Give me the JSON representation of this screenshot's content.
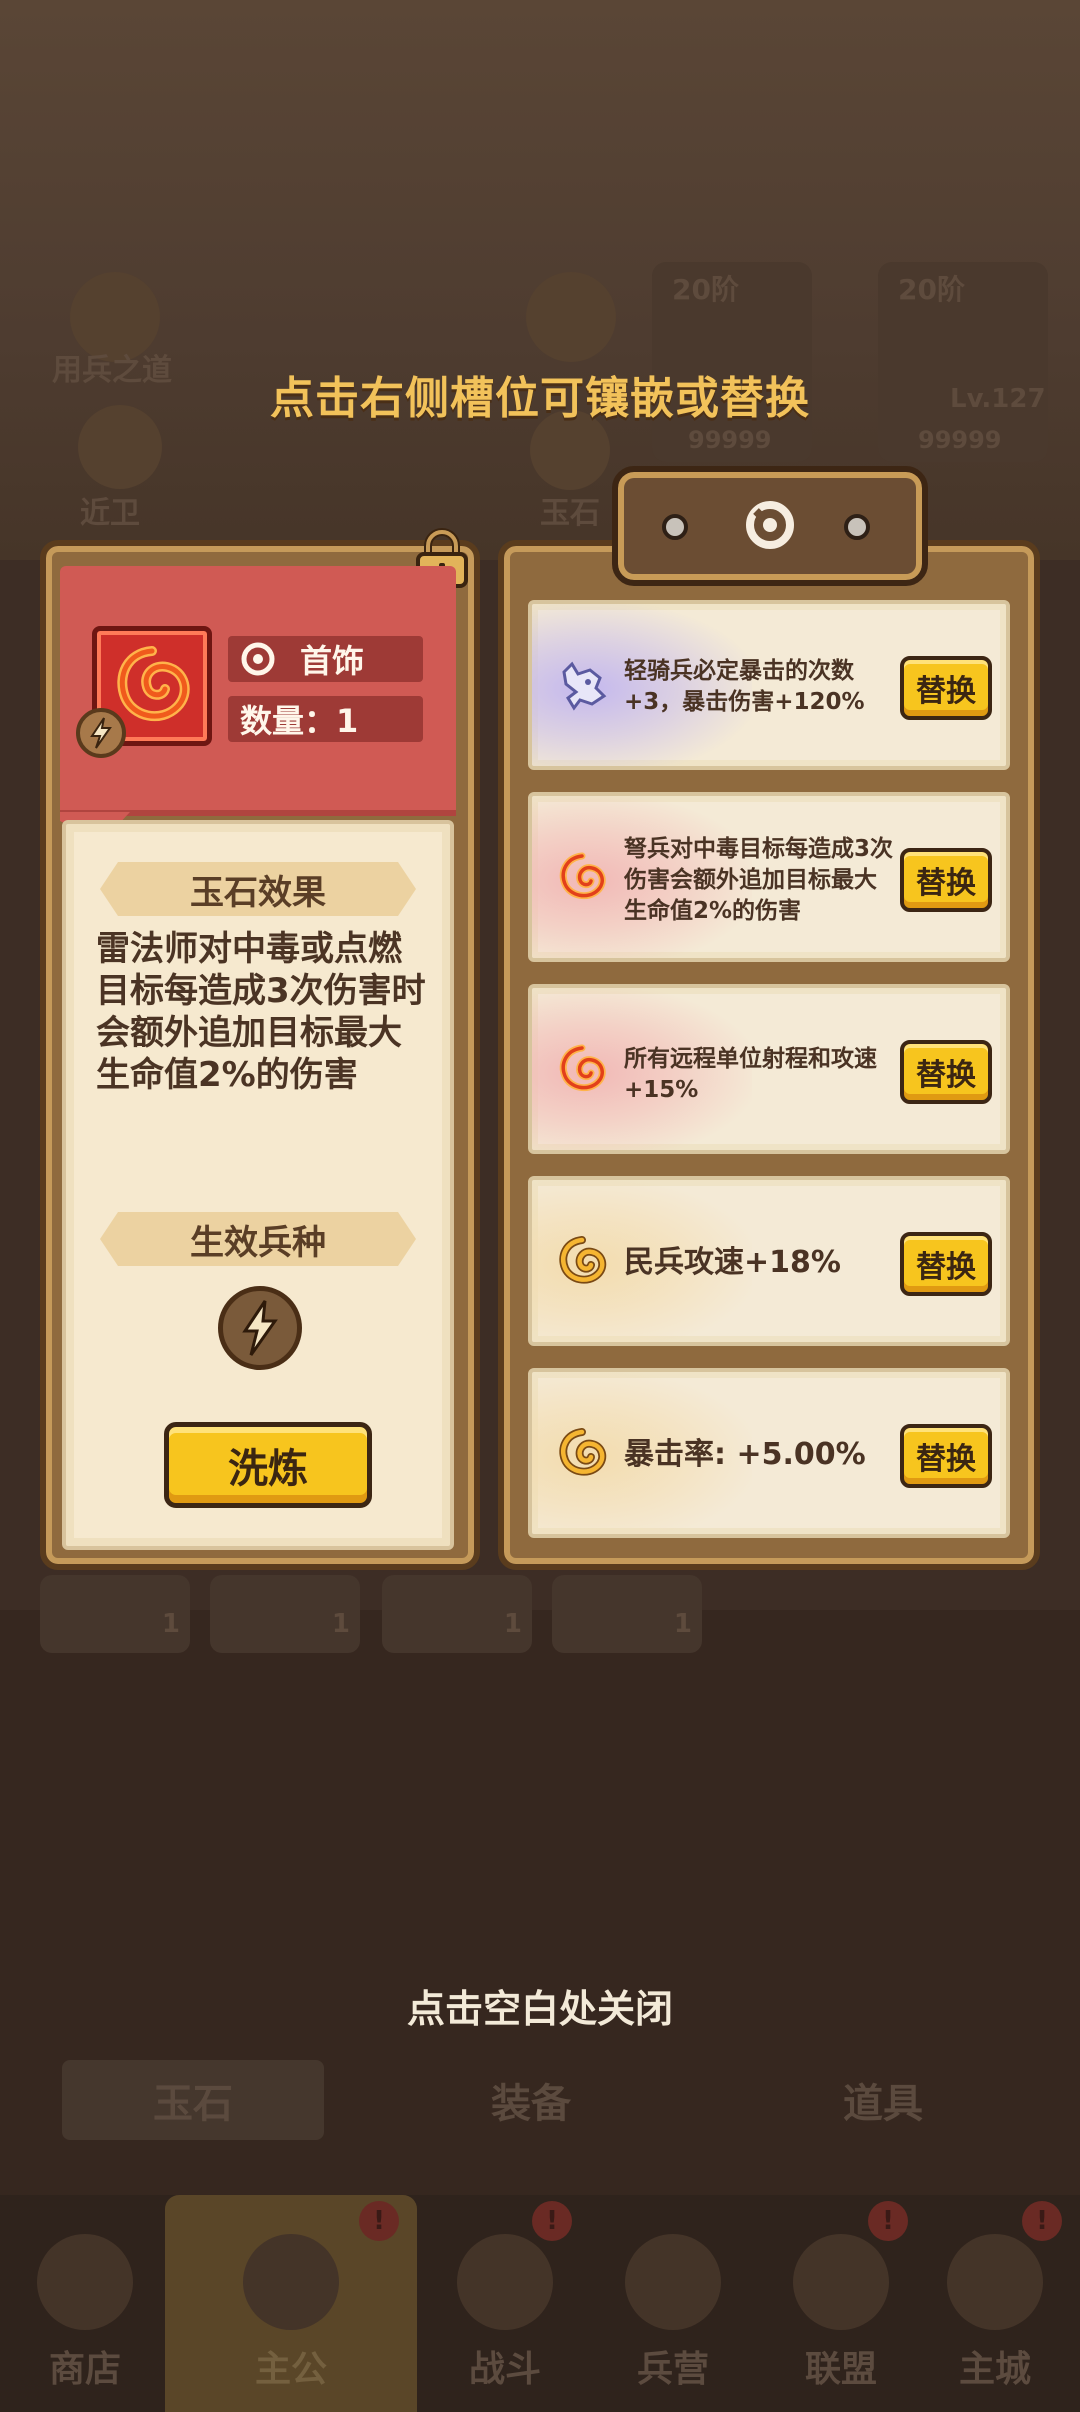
{
  "background": {
    "top_labels": [
      "用兵之道",
      "近卫",
      "玉石"
    ],
    "hero_cards": [
      {
        "tier": "20阶",
        "stars": "99999"
      },
      {
        "tier": "20阶",
        "level": "Lv.127",
        "stars": "99999"
      }
    ],
    "slot_counts": [
      "1",
      "1",
      "1",
      "1"
    ],
    "tabs": [
      "玉石",
      "装备",
      "道具"
    ],
    "nav_items": [
      {
        "label": "商店",
        "active": false
      },
      {
        "label": "主公",
        "active": true
      },
      {
        "label": "战斗",
        "active": false
      },
      {
        "label": "兵营",
        "active": false
      },
      {
        "label": "联盟",
        "active": false
      },
      {
        "label": "主城",
        "active": false
      }
    ]
  },
  "hint_top": "点击右侧槽位可镶嵌或替换",
  "hint_bottom": "点击空白处关闭",
  "left": {
    "category": "首饰",
    "quantity_label": "数量：1",
    "effect_title": "玉石效果",
    "effect_text": "雷法师对中毒或点燃目标每造成3次伤害时会额外追加目标最大生命值2%的伤害",
    "troop_title": "生效兵种",
    "refine_label": "洗炼"
  },
  "right": {
    "rows": [
      {
        "text": "轻骑兵必定暴击的次数+3，暴击伤害+120%",
        "icon": "wolf-gem-icon",
        "glow": "#c4b8ee",
        "button": "替换"
      },
      {
        "text": "弩兵对中毒目标每造成3次伤害会额外追加目标最大生命值2%的伤害",
        "icon": "red-swirl-gem-icon",
        "glow": "#f2b8b6",
        "button": "替换"
      },
      {
        "text": "所有远程单位射程和攻速+15%",
        "icon": "red-swirl-gem-icon",
        "glow": "#f2b8b6",
        "button": "替换"
      },
      {
        "text": "民兵攻速+18%",
        "icon": "gold-swirl-gem-icon",
        "glow": "#f3dcae",
        "button": "替换"
      },
      {
        "text": "暴击率: +5.00%",
        "icon": "gold-swirl-gem-icon",
        "glow": "#f3dcae",
        "button": "替换"
      }
    ]
  },
  "colors": {
    "button": "#f7c51e",
    "header_red": "#d05a54",
    "hint": "#f2c25a"
  }
}
